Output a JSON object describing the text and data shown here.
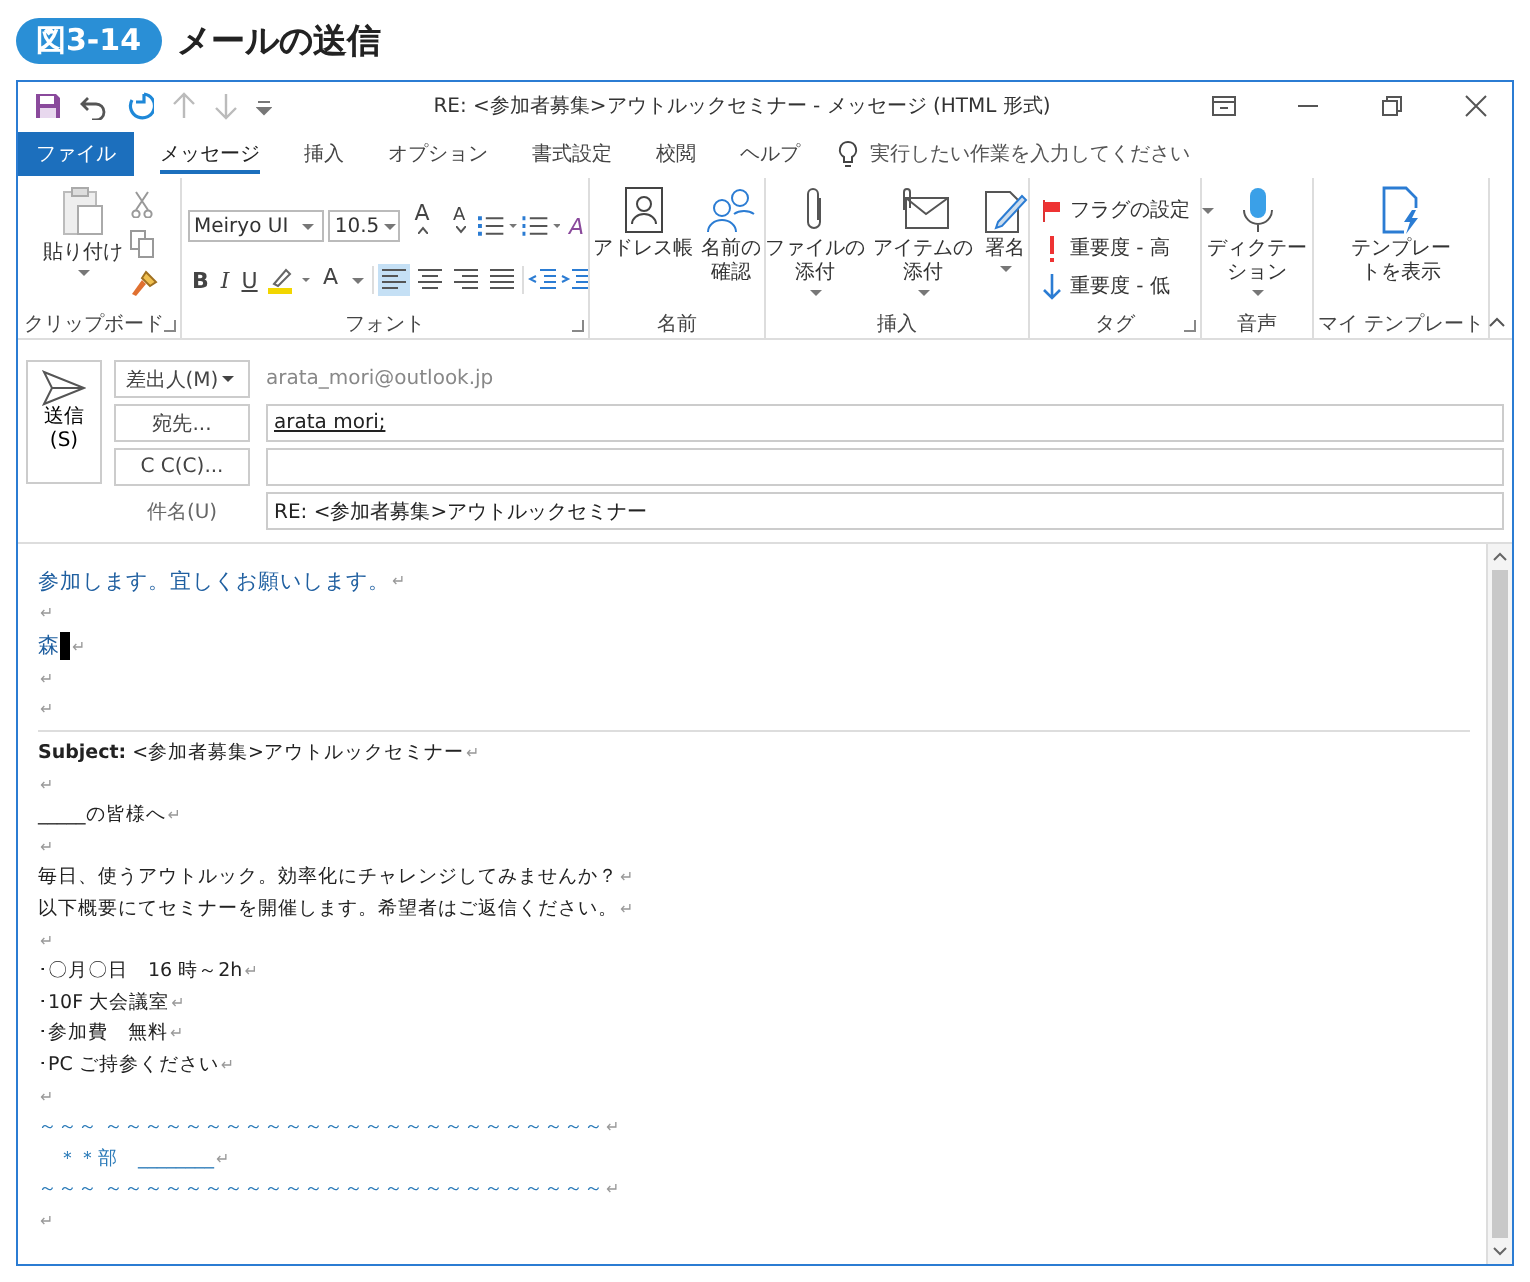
{
  "figure": {
    "number": "図3-14",
    "title": "メールの送信"
  },
  "window": {
    "title": "RE: <参加者募集>アウトルックセミナー  -  メッセージ (HTML 形式)"
  },
  "tabs": [
    {
      "label": "ファイル",
      "kind": "file",
      "selected": false
    },
    {
      "label": "メッセージ",
      "kind": "tab",
      "selected": true
    },
    {
      "label": "挿入",
      "kind": "tab",
      "selected": false
    },
    {
      "label": "オプション",
      "kind": "tab",
      "selected": false
    },
    {
      "label": "書式設定",
      "kind": "tab",
      "selected": false
    },
    {
      "label": "校閲",
      "kind": "tab",
      "selected": false
    },
    {
      "label": "ヘルプ",
      "kind": "tab",
      "selected": false
    }
  ],
  "tell_me": {
    "placeholder": "実行したい作業を入力してください"
  },
  "ribbon": {
    "clipboard": {
      "paste": "貼り付け",
      "label": "クリップボード"
    },
    "font": {
      "label": "フォント",
      "font_name": "Meiryo UI",
      "font_size": "10.5",
      "grow": "A",
      "shrink": "A",
      "bold": "B",
      "italic": "I",
      "underline": "U",
      "clear": "A",
      "font_color_letter": "A",
      "alignments": [
        {
          "kind": "left",
          "selected": true
        },
        {
          "kind": "center",
          "selected": false
        },
        {
          "kind": "right",
          "selected": false
        },
        {
          "kind": "justify",
          "selected": false
        }
      ]
    },
    "names": {
      "label": "名前",
      "buttons": [
        {
          "lines": [
            "アドレス帳"
          ],
          "kind": "book"
        },
        {
          "lines": [
            "名前の",
            "確認"
          ],
          "kind": "people"
        }
      ]
    },
    "insert": {
      "label": "挿入",
      "buttons": [
        {
          "lines": [
            "ファイルの",
            "添付"
          ],
          "kind": "clip",
          "dropdown": true
        },
        {
          "lines": [
            "アイテムの",
            "添付"
          ],
          "kind": "envelope",
          "dropdown": true
        },
        {
          "lines": [
            "署名"
          ],
          "kind": "pen",
          "dropdown": true
        }
      ]
    },
    "tags": {
      "label": "タグ",
      "items": [
        {
          "label": "フラグの設定",
          "kind": "flag",
          "dropdown": true
        },
        {
          "label": "重要度 - 高",
          "kind": "high",
          "dropdown": false
        },
        {
          "label": "重要度 - 低",
          "kind": "low",
          "dropdown": false
        }
      ]
    },
    "voice": {
      "label": "音声",
      "button": [
        "ディクテー",
        "ション"
      ],
      "dropdown": true
    },
    "template": {
      "label": "マイ テンプレート",
      "button": [
        "テンプレー",
        "トを表示"
      ]
    }
  },
  "header": {
    "send": [
      "送信",
      "(S)"
    ],
    "from_button": "差出人(M)",
    "from": "arata_mori@outlook.jp",
    "to_button": "宛先...",
    "to": "arata mori;",
    "cc_button": "C C(C)...",
    "subject_label": "件名(U)",
    "subject": "RE: <参加者募集>アウトルックセミナー"
  },
  "body": [
    {
      "kind": "reply",
      "text": "参加します。宜しくお願いします。",
      "mark": "↵"
    },
    {
      "kind": "blank",
      "mark": "↵"
    },
    {
      "kind": "reply",
      "text": "森",
      "cursor": true,
      "mark": "↵"
    },
    {
      "kind": "blank",
      "mark": "↵"
    },
    {
      "kind": "blank",
      "mark": "↵"
    },
    {
      "kind": "rule"
    },
    {
      "kind": "quote",
      "text": "**Subject:** <参加者募集>アウトルックセミナー",
      "mark": "↵"
    },
    {
      "kind": "blank",
      "mark": "↵"
    },
    {
      "kind": "quote",
      "text": "_____の皆様へ",
      "mark": "↵"
    },
    {
      "kind": "blank",
      "mark": "↵"
    },
    {
      "kind": "quote",
      "text": "毎日、使うアウトルック。効率化にチャレンジしてみませんか？",
      "mark": "↵"
    },
    {
      "kind": "quote",
      "text": "以下概要にてセミナーを開催します。希望者はご返信ください。",
      "mark": "↵"
    },
    {
      "kind": "blank",
      "mark": "↵"
    },
    {
      "kind": "quote",
      "text": "･〇月〇日　16 時～2h",
      "mark": "↵"
    },
    {
      "kind": "quote",
      "text": "･10F 大会議室",
      "mark": "↵"
    },
    {
      "kind": "quote",
      "text": "･参加費　無料",
      "mark": "↵"
    },
    {
      "kind": "quote",
      "text": "･PC ご持参ください",
      "mark": "↵"
    },
    {
      "kind": "blank",
      "mark": "↵"
    },
    {
      "kind": "signature",
      "text": "～～～ ～～～～～～～～～～～～～～～～～～～～～～～～～",
      "mark": "↵"
    },
    {
      "kind": "signature",
      "text": "　＊＊部　________",
      "mark": "↵"
    },
    {
      "kind": "signature",
      "text": "～～～ ～～～～～～～～～～～～～～～～～～～～～～～～～",
      "mark": "↵"
    },
    {
      "kind": "blank",
      "mark": "↵"
    }
  ]
}
